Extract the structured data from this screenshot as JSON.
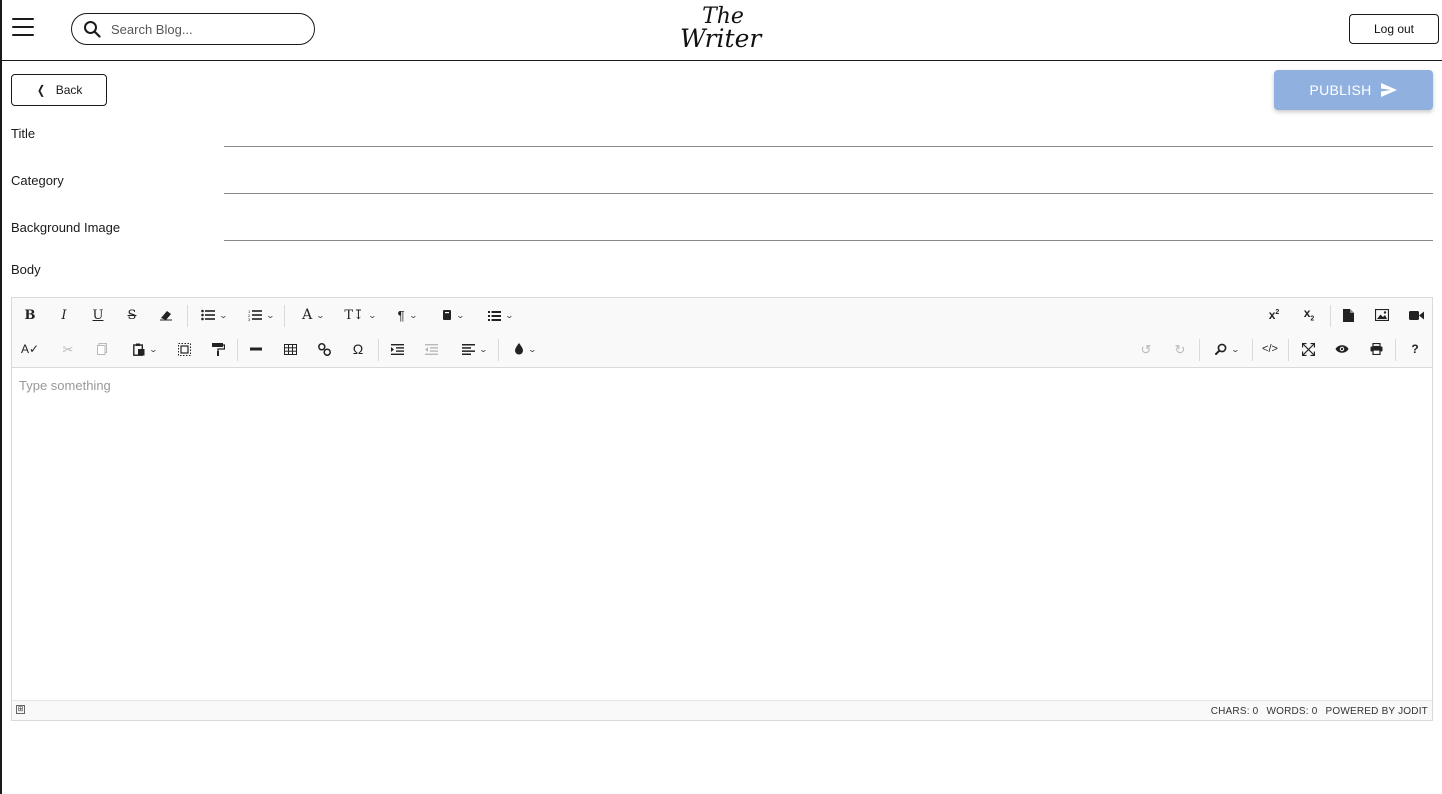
{
  "header": {
    "search_placeholder": "Search Blog...",
    "logo_line1": "The",
    "logo_line2": "Writer",
    "logout_label": "Log out"
  },
  "actions": {
    "back_label": "Back",
    "publish_label": "PUBLISH",
    "publish_color": "#90b1e0"
  },
  "form": {
    "title_label": "Title",
    "category_label": "Category",
    "background_label": "Background Image",
    "body_label": "Body"
  },
  "editor": {
    "placeholder": "Type something",
    "toolbar_row1": [
      "bold",
      "italic",
      "underline",
      "strikethrough",
      "eraser",
      "unordered-list",
      "ordered-list",
      "font",
      "font-size",
      "paragraph",
      "classes",
      "line-height",
      "superscript",
      "subscript",
      "file",
      "image",
      "video"
    ],
    "toolbar_row2": [
      "spellcheck",
      "cut",
      "copy",
      "paste",
      "select-all",
      "copy-format",
      "horizontal-rule",
      "table",
      "link",
      "symbols",
      "indent",
      "outdent",
      "align",
      "brush",
      "undo",
      "redo",
      "find",
      "source",
      "fullsize",
      "preview",
      "print",
      "about"
    ],
    "status": {
      "chars": "CHARS: 0",
      "words": "WORDS: 0",
      "powered": "POWERED BY JODIT"
    }
  }
}
